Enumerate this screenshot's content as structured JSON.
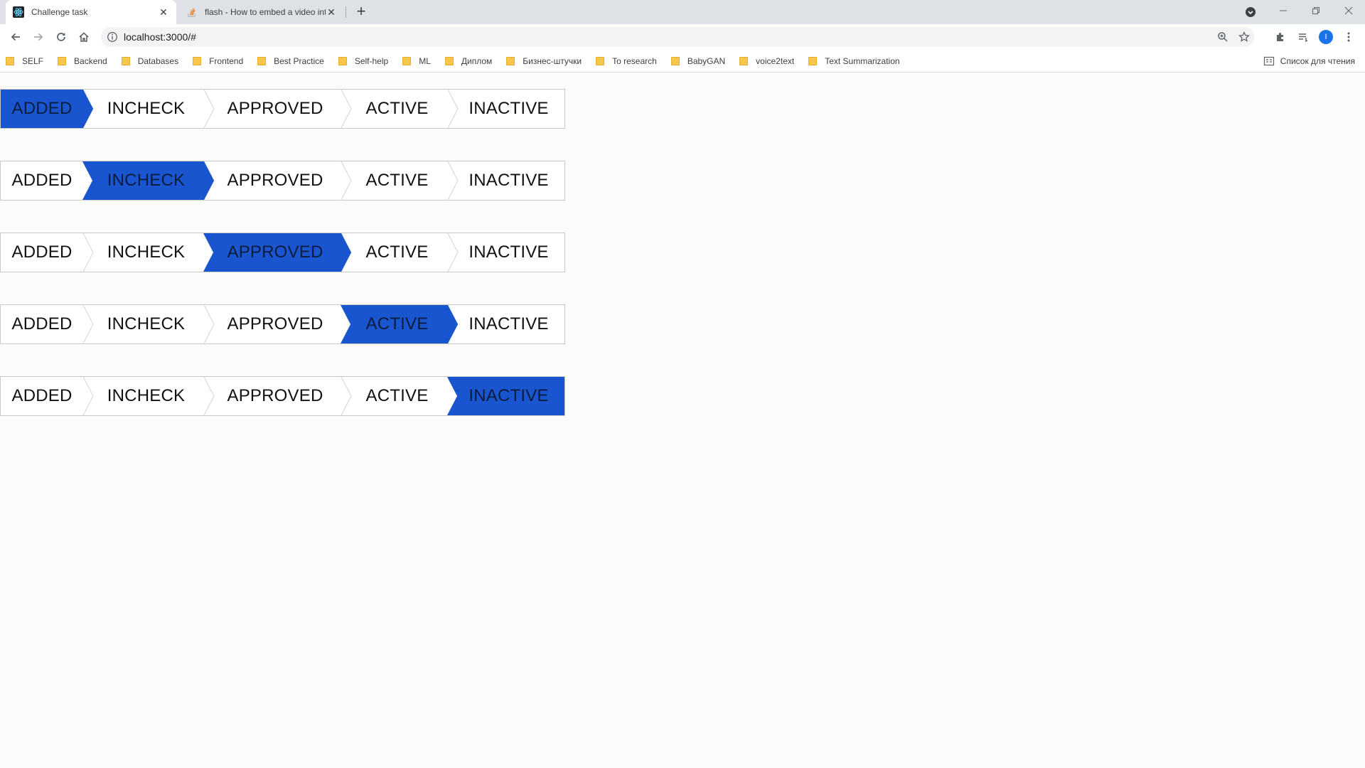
{
  "browser": {
    "tabs": [
      {
        "title": "Challenge task",
        "active": true
      },
      {
        "title": "flash - How to embed a video int",
        "active": false
      }
    ],
    "url": "localhost:3000/#",
    "bookmarks": [
      "SELF",
      "Backend",
      "Databases",
      "Frontend",
      "Best Practice",
      "Self-help",
      "ML",
      "Диплом",
      "Бизнес-штучки",
      "To research",
      "BabyGAN",
      "voice2text",
      "Text Summarization"
    ],
    "reading_list": "Список для чтения",
    "profile_initial": "I"
  },
  "status_steps": [
    "ADDED",
    "INCHECK",
    "APPROVED",
    "ACTIVE",
    "INACTIVE"
  ],
  "status_bars": [
    {
      "active_index": 0
    },
    {
      "active_index": 1
    },
    {
      "active_index": 2
    },
    {
      "active_index": 3
    },
    {
      "active_index": 4
    }
  ],
  "colors": {
    "active_fill": "#1a55d0",
    "border": "#c8c8c8",
    "chevron": "#d4d4d4",
    "tabstrip": "#dee1e6"
  }
}
